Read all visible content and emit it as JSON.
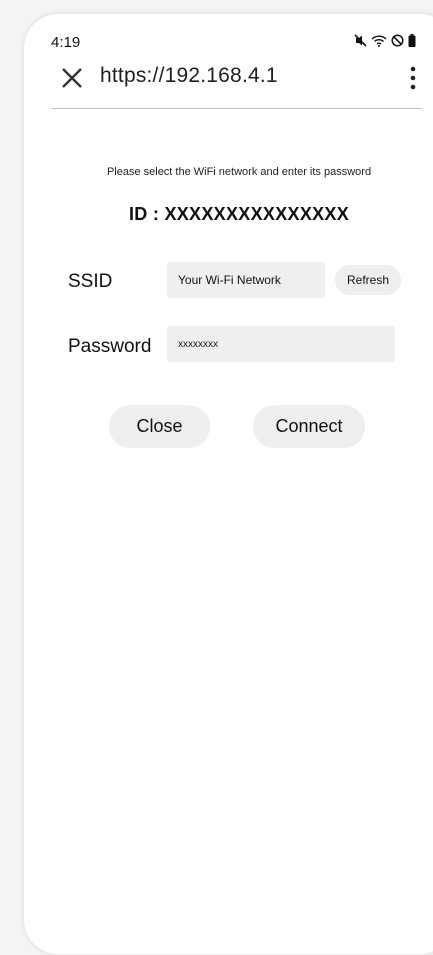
{
  "status_bar": {
    "time": "4:19",
    "icons": [
      "mute-icon",
      "wifi-icon",
      "do-not-disturb-icon",
      "battery-icon"
    ]
  },
  "browser": {
    "url": "https://192.168.4.1",
    "close_icon": "close-icon",
    "menu_icon": "kebab-menu-icon"
  },
  "form": {
    "instruction": "Please select the WiFi network and enter its password",
    "device_id": "ID : XXXXXXXXXXXXXXX",
    "ssid_label": "SSID",
    "ssid_value": "Your Wi-Fi Network",
    "refresh_label": "Refresh",
    "password_label": "Password",
    "password_value": "xxxxxxxx",
    "close_label": "Close",
    "connect_label": "Connect"
  }
}
